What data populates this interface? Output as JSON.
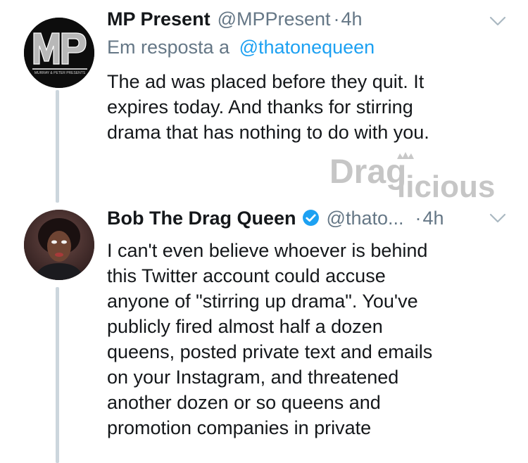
{
  "colors": {
    "text": "#14171a",
    "secondary": "#657786",
    "link": "#1da1f2",
    "thread_line": "#ccd6dd",
    "verified": "#1da1f2"
  },
  "tweets": [
    {
      "display_name": "MP Present",
      "handle": "@MPPresent",
      "separator": "·",
      "time": "4h",
      "reply_prefix": "Em resposta a",
      "reply_to": "@thatonequeen",
      "lines": [
        "The ad was placed before they quit. It",
        "expires today. And thanks for stirring",
        "drama that has nothing to do with you."
      ],
      "avatar": {
        "logo_text": "MP",
        "subtitle": "MURRAY & PETER PRESENTS"
      },
      "menu_icon": "chevron-down-icon"
    },
    {
      "display_name": "Bob The Drag Queen",
      "handle": "@thato...",
      "separator": "·",
      "time": "4h",
      "verified": true,
      "lines": [
        "I can't even believe whoever is behind",
        "this Twitter account could accuse",
        "anyone of \"stirring up drama\". You've",
        "publicly fired almost half a dozen",
        "queens, posted private text and emails",
        "on your Instagram, and threatened",
        "another dozen or so queens and",
        "promotion companies in private"
      ],
      "menu_icon": "chevron-down-icon"
    }
  ],
  "watermark": {
    "text_top": "Drag",
    "text_bottom": "licious",
    "icon": "crown-icon"
  }
}
